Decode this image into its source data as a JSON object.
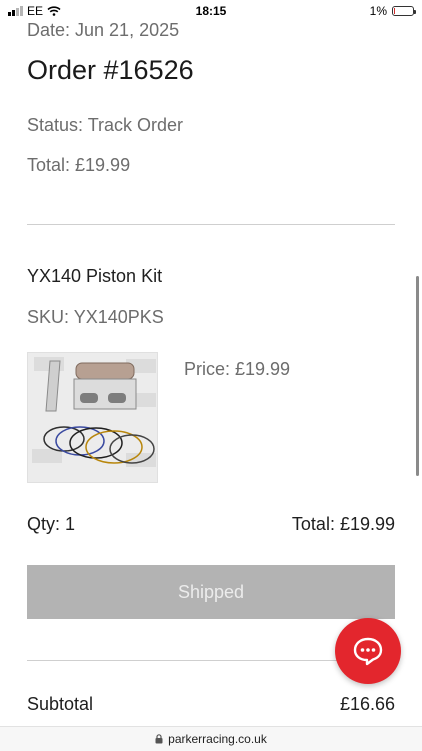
{
  "status_bar": {
    "carrier": "EE",
    "time": "18:15",
    "battery_percent": "1%",
    "battery_level": 0.01,
    "battery_color": "#d32f2f"
  },
  "order": {
    "date": "Date: Jun 21, 2025",
    "title": "Order #16526",
    "status": "Status: Track Order",
    "total": "Total: £19.99"
  },
  "item": {
    "name": "YX140 Piston Kit",
    "sku": "SKU: YX140PKS",
    "image_icon": "piston-kit-product-image",
    "price": "Price: £19.99",
    "qty": "Qty: 1",
    "line_total": "Total: £19.99",
    "fulfillment_status": "Shipped"
  },
  "summary": {
    "subtotal_label": "Subtotal",
    "subtotal_value": "£16.66"
  },
  "chat": {
    "icon": "chat-bubble-icon",
    "color": "#e3262d"
  },
  "browser": {
    "domain": "parkerracing.co.uk",
    "lock_icon": "lock-icon"
  }
}
